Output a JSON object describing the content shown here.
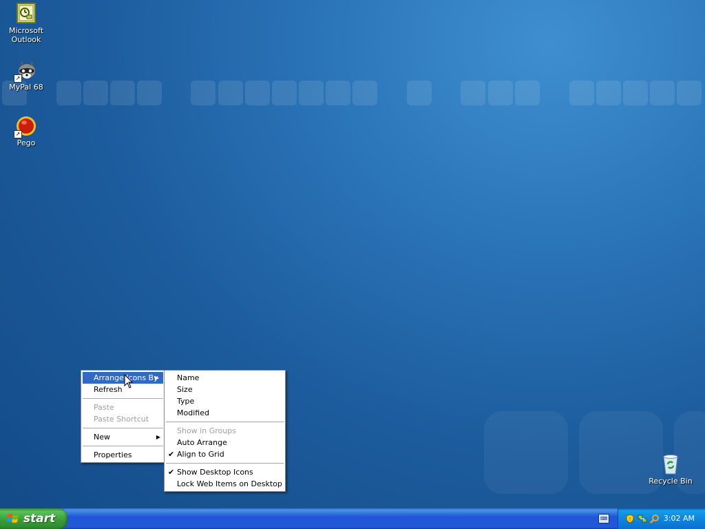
{
  "desktop": {
    "icons": [
      {
        "label_line1": "Microsoft",
        "label_line2": "Outlook",
        "icon": "outlook-icon"
      },
      {
        "label_line1": "MyPal 68",
        "label_line2": "",
        "icon": "raccoon-icon"
      },
      {
        "label_line1": "Pego",
        "label_line2": "",
        "icon": "pego-ball-icon"
      },
      {
        "label_line1": "Recycle Bin",
        "label_line2": "",
        "icon": "recycle-bin-icon"
      }
    ]
  },
  "context_menu": {
    "items": [
      {
        "label": "Arrange Icons By",
        "state": "highlighted",
        "submenu": true
      },
      {
        "label": "Refresh",
        "state": "enabled"
      },
      {
        "label": "Paste",
        "state": "disabled"
      },
      {
        "label": "Paste Shortcut",
        "state": "disabled"
      },
      {
        "label": "New",
        "state": "enabled",
        "submenu": true
      },
      {
        "label": "Properties",
        "state": "enabled"
      }
    ]
  },
  "arrange_submenu": {
    "items": [
      {
        "label": "Name"
      },
      {
        "label": "Size"
      },
      {
        "label": "Type"
      },
      {
        "label": "Modified"
      },
      {
        "label": "Show in Groups",
        "state": "disabled"
      },
      {
        "label": "Auto Arrange"
      },
      {
        "label": "Align to Grid",
        "checked": true
      },
      {
        "label": "Show Desktop Icons",
        "checked": true
      },
      {
        "label": "Lock Web Items on Desktop"
      }
    ]
  },
  "taskbar": {
    "start_label": "start",
    "clock": "3:02 AM",
    "tray_icons": [
      "security-shield-icon",
      "network-icon",
      "search-icon"
    ]
  },
  "colors": {
    "menu_highlight": "#316ac5",
    "taskbar_blue": "#2257d5",
    "start_green": "#3c9a3c"
  }
}
